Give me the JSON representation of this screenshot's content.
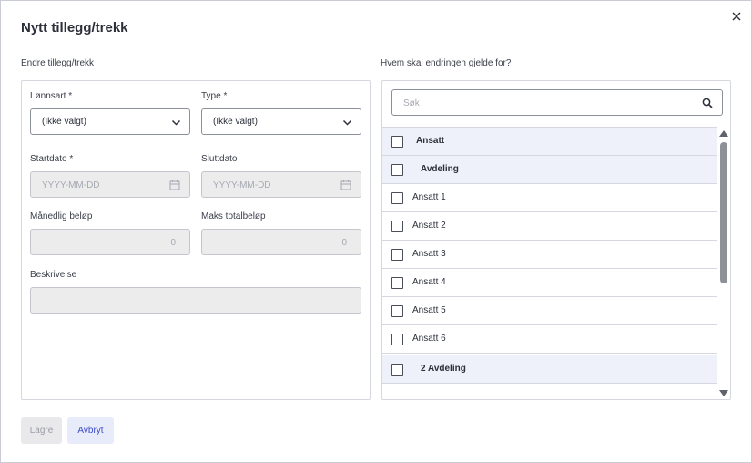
{
  "dialog": {
    "title": "Nytt tillegg/trekk"
  },
  "left": {
    "section_label": "Endre tillegg/trekk",
    "lonnsart": {
      "label": "Lønnsart *",
      "value": "(Ikke valgt)"
    },
    "type": {
      "label": "Type *",
      "value": "(Ikke valgt)"
    },
    "startdato": {
      "label": "Startdato *",
      "placeholder": "YYYY-MM-DD"
    },
    "sluttdato": {
      "label": "Sluttdato",
      "placeholder": "YYYY-MM-DD"
    },
    "manedlig": {
      "label": "Månedlig beløp",
      "value": "0"
    },
    "maks": {
      "label": "Maks totalbeløp",
      "value": "0"
    },
    "beskrivelse": {
      "label": "Beskrivelse",
      "value": ""
    }
  },
  "right": {
    "section_label": "Hvem skal endringen gjelde for?",
    "search": {
      "placeholder": "Søk"
    },
    "rows": [
      {
        "label": "Ansatt",
        "group": true,
        "checked": false
      },
      {
        "label": "Avdeling",
        "group": true,
        "checked": false
      },
      {
        "label": "Ansatt 1",
        "group": false,
        "checked": false
      },
      {
        "label": "Ansatt 2",
        "group": false,
        "checked": false
      },
      {
        "label": "Ansatt 3",
        "group": false,
        "checked": false
      },
      {
        "label": "Ansatt 4",
        "group": false,
        "checked": false
      },
      {
        "label": "Ansatt 5",
        "group": false,
        "checked": false
      },
      {
        "label": "Ansatt 6",
        "group": false,
        "checked": false
      },
      {
        "label": "2 Avdeling",
        "group": true,
        "checked": false
      }
    ]
  },
  "footer": {
    "save_label": "Lagre",
    "cancel_label": "Avbryt"
  },
  "colors": {
    "accent": "#3b4bc9",
    "group_row_bg": "#eef1fa",
    "disabled_bg": "#ececed"
  },
  "icons": {
    "close": "close-icon",
    "chevron": "chevron-down-icon",
    "calendar": "calendar-icon",
    "search": "search-icon"
  }
}
